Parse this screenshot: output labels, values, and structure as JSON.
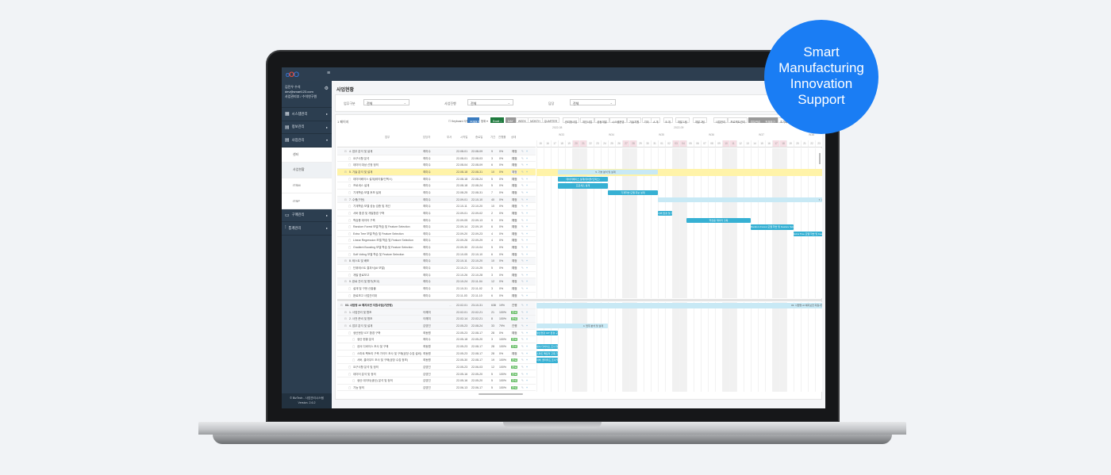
{
  "badge": {
    "lines": [
      "Smart",
      "Manufacturing",
      "Innovation",
      "Support"
    ],
    "color": "#1a7df4"
  },
  "app": {
    "logo": "oOO",
    "menu_icon": "hamburger-icon"
  },
  "sidebar": {
    "user_name": "김진우 수석",
    "user_email": "dev@smart123.com",
    "user_dept": "사업관리부 / 수석연구원",
    "menus": [
      {
        "label": "시스템관리",
        "icon": "grid-icon"
      },
      {
        "label": "정보관리",
        "icon": "clipboard-icon"
      },
      {
        "label": "사업관리",
        "icon": "clipboard-icon",
        "expanded": true
      }
    ],
    "sub_items": [
      {
        "label": "센터"
      },
      {
        "label": "사업현황",
        "active": true
      },
      {
        "label": "ITSM"
      },
      {
        "label": "ITSP"
      }
    ],
    "menus_after": [
      {
        "label": "구매관리",
        "icon": "card-icon"
      },
      {
        "label": "통계관리",
        "icon": "chart-icon"
      }
    ],
    "footer_copyright": "© BizTech - 사업관리시스템",
    "footer_version": "Version. 2.6.2"
  },
  "page": {
    "title": "사업현황",
    "filters": [
      {
        "label": "업무구분",
        "value": "전체"
      },
      {
        "label": "사업진행",
        "value": "전체"
      },
      {
        "label": "담당",
        "value": "전체"
      }
    ],
    "page_info": "1 페이지"
  },
  "toolbar": {
    "keyboard_label": "Keyboard 사용",
    "expand_all": "전체펴기",
    "range": "범위 ▾",
    "excel": "Excel ↓",
    "scales": [
      "DAY",
      "WEEK",
      "MONTH",
      "QUARTER"
    ],
    "active_scale": "DAY",
    "filters": [
      "관리형사업",
      "개인사업",
      "공동개발",
      "시스템운영",
      "기술지원",
      "기타",
      "A 개",
      "B 개",
      "개발 1팀",
      "개발 2팀"
    ],
    "actions": [
      "사업관리",
      "프로젝트관리",
      "업무관리",
      "전체보기",
      "초기화"
    ]
  },
  "table": {
    "columns": [
      "업무",
      "담당자",
      "부서",
      "시작일",
      "종료일",
      "기간",
      "진행률",
      "상태"
    ],
    "upper_rows": [
      {
        "name": "4. 업무 분석 및 설계",
        "owner": "최미수",
        "start": "22-08-01",
        "end": "22-08-09",
        "days": "9",
        "progress": "0%",
        "status": "예정",
        "level": 1,
        "group": true
      },
      {
        "name": "요구사항 분석",
        "owner": "최미수",
        "start": "22-08-01",
        "end": "22-08-03",
        "days": "3",
        "progress": "0%",
        "status": "예정",
        "level": 2
      },
      {
        "name": "데이터 대상 선정 정의",
        "owner": "최미수",
        "start": "22-08-04",
        "end": "22-08-09",
        "days": "6",
        "progress": "0%",
        "status": "예정",
        "level": 2
      },
      {
        "name": "5. 기술 분석 및 설계",
        "owner": "최미수",
        "start": "22-08-18",
        "end": "22-08-31",
        "days": "10",
        "progress": "0%",
        "status": "예정",
        "level": 1,
        "group": true,
        "highlight": true
      },
      {
        "name": "데이터베이스 설계(테이블/인덱스)",
        "owner": "최미수",
        "start": "22-08-18",
        "end": "22-08-24",
        "days": "5",
        "progress": "0%",
        "status": "예정",
        "level": 2
      },
      {
        "name": "프로세스 설계",
        "owner": "최미수",
        "start": "22-08-18",
        "end": "22-08-24",
        "days": "5",
        "progress": "0%",
        "status": "예정",
        "level": 2
      },
      {
        "name": "기계학습 모델 후보 설계",
        "owner": "최미수",
        "start": "22-08-25",
        "end": "22-08-31",
        "days": "7",
        "progress": "0%",
        "status": "예정",
        "level": 2
      },
      {
        "name": "7. 수행(구현)",
        "owner": "최미수",
        "start": "22-09-01",
        "end": "22-10-10",
        "days": "40",
        "progress": "0%",
        "status": "예정",
        "level": 1,
        "group": true
      },
      {
        "name": "기계학습 모델 성능 검증 및 개선",
        "owner": "최미수",
        "start": "22-10-11",
        "end": "22-10-20",
        "days": "10",
        "progress": "0%",
        "status": "예정",
        "level": 2
      },
      {
        "name": "서버 환경 및 개발환경 구축",
        "owner": "최미수",
        "start": "22-09-01",
        "end": "22-09-02",
        "days": "2",
        "progress": "0%",
        "status": "예정",
        "level": 2
      },
      {
        "name": "학습용 데이터 구축",
        "owner": "최미수",
        "start": "22-09-05",
        "end": "22-09-13",
        "days": "9",
        "progress": "0%",
        "status": "예정",
        "level": 2
      },
      {
        "name": "Random Forest 모델 학습 및 Feature Selection",
        "owner": "최미수",
        "start": "22-09-14",
        "end": "22-09-19",
        "days": "6",
        "progress": "0%",
        "status": "예정",
        "level": 2
      },
      {
        "name": "Extra Tree 모델 학습 및 Feature Selection",
        "owner": "최미수",
        "start": "22-09-20",
        "end": "22-09-23",
        "days": "4",
        "progress": "0%",
        "status": "예정",
        "level": 2
      },
      {
        "name": "Linear Regression 모델 학습 및 Feature Selection",
        "owner": "최미수",
        "start": "22-09-26",
        "end": "22-09-29",
        "days": "4",
        "progress": "0%",
        "status": "예정",
        "level": 2
      },
      {
        "name": "Gradient Boosting 모델 학습 및 Feature Selection",
        "owner": "최미수",
        "start": "22-09-30",
        "end": "22-10-04",
        "days": "5",
        "progress": "0%",
        "status": "예정",
        "level": 2
      },
      {
        "name": "Soft Voting 모델 학습 및 Feature Selection",
        "owner": "최미수",
        "start": "22-10-05",
        "end": "22-10-10",
        "days": "6",
        "progress": "0%",
        "status": "예정",
        "level": 2
      },
      {
        "name": "8. 테스트 및 배포",
        "owner": "최미수",
        "start": "22-10-11",
        "end": "22-10-20",
        "days": "10",
        "progress": "0%",
        "status": "예정",
        "level": 1,
        "group": true
      },
      {
        "name": "단위테스트 결과서(AI 모델)",
        "owner": "최미수",
        "start": "22-10-21",
        "end": "22-10-25",
        "days": "5",
        "progress": "0%",
        "status": "예정",
        "level": 2
      },
      {
        "name": "개발 완료보고",
        "owner": "최미수",
        "start": "22-10-26",
        "end": "22-10-28",
        "days": "3",
        "progress": "0%",
        "status": "예정",
        "level": 2
      },
      {
        "name": "9. 완료 관리 및 평가(보고)",
        "owner": "최미수",
        "start": "22-10-24",
        "end": "22-11-04",
        "days": "12",
        "progress": "0%",
        "status": "예정",
        "level": 1,
        "group": true
      },
      {
        "name": "설계 및 구현 산출물",
        "owner": "최미수",
        "start": "22-10-31",
        "end": "22-11-02",
        "days": "3",
        "progress": "0%",
        "status": "예정",
        "level": 2
      },
      {
        "name": "완료보고 사업관리대",
        "owner": "최미수",
        "start": "22-11-03",
        "end": "22-11-10",
        "days": "6",
        "progress": "0%",
        "status": "예정",
        "level": 2
      }
    ],
    "lower_rows": [
      {
        "name": "03. 사업명 AI 예지보전 지원사업(기관명)",
        "owner": "",
        "dept": "…",
        "start": "22-02-01",
        "end": "23-10-31",
        "days": "638",
        "progress": "19%",
        "status": "진행",
        "level": 0,
        "group": true
      },
      {
        "name": "1. 사업관리 및 협조",
        "owner": "이해미",
        "start": "22-02-01",
        "end": "22-02-21",
        "days": "21",
        "progress": "100%",
        "status": "완료",
        "level": 1,
        "group": true
      },
      {
        "name": "2. 사전 준비 및 협조",
        "owner": "이해미",
        "start": "22-02-14",
        "end": "22-02-21",
        "days": "8",
        "progress": "100%",
        "status": "완료",
        "level": 1,
        "group": true
      },
      {
        "name": "4. 업무 분석 및 설계",
        "owner": "김영진",
        "start": "22-05-23",
        "end": "22-08-24",
        "days": "33",
        "progress": "79%",
        "status": "진행",
        "level": 1,
        "group": true
      },
      {
        "name": "생산현장 IOT 환경 구축",
        "owner": "최동원",
        "start": "22-05-23",
        "end": "22-08-17",
        "days": "28",
        "progress": "0%",
        "status": "예정",
        "level": 2
      },
      {
        "name": "생산 현황 분석",
        "owner": "최미수",
        "start": "22-05-18",
        "end": "22-05-20",
        "days": "3",
        "progress": "100%",
        "status": "완료",
        "level": 3
      },
      {
        "name": "센서 디바이스 조사 및 구매",
        "owner": "최동원",
        "start": "22-05-23",
        "end": "22-08-17",
        "days": "28",
        "progress": "100%",
        "status": "완료",
        "level": 3
      },
      {
        "name": "스마트 팩토리 구축 가이드 조사 및 구매(공장 수집 설비)",
        "owner": "최동원",
        "start": "22-05-23",
        "end": "22-08-17",
        "days": "28",
        "progress": "0%",
        "status": "예정",
        "level": 3
      },
      {
        "name": "서버, 클라우드 조사 및 구매(공장 수집 정보)",
        "owner": "최동원",
        "start": "22-05-30",
        "end": "22-08-17",
        "days": "19",
        "progress": "100%",
        "status": "완료",
        "level": 3
      },
      {
        "name": "요구사항 분석 및 정의",
        "owner": "김영진",
        "start": "22-05-23",
        "end": "22-06-03",
        "days": "12",
        "progress": "100%",
        "status": "완료",
        "level": 2
      },
      {
        "name": "데이터 분석 및 정의",
        "owner": "김영진",
        "start": "22-05-16",
        "end": "22-05-20",
        "days": "5",
        "progress": "100%",
        "status": "완료",
        "level": 2
      },
      {
        "name": "생산 데이터(생산) 분석 및 정의",
        "owner": "김영진",
        "start": "22-05-16",
        "end": "22-05-20",
        "days": "5",
        "progress": "100%",
        "status": "완료",
        "level": 3
      },
      {
        "name": "기능 정의",
        "owner": "김영진",
        "start": "22-06-13",
        "end": "22-06-17",
        "days": "5",
        "progress": "100%",
        "status": "완료",
        "level": 2
      }
    ]
  },
  "gantt": {
    "start": "2022-08-15",
    "days": 40,
    "months": [
      {
        "label": "2022-08",
        "day": 0
      },
      {
        "label": "2022-09",
        "day": 17
      }
    ],
    "weeks": [
      "W33",
      "W34",
      "W35",
      "W36",
      "W37",
      "W38"
    ],
    "bar_color": "#36b0d3",
    "summary_color": "#c8e9f5",
    "highlight_color": "#fff3a8"
  }
}
